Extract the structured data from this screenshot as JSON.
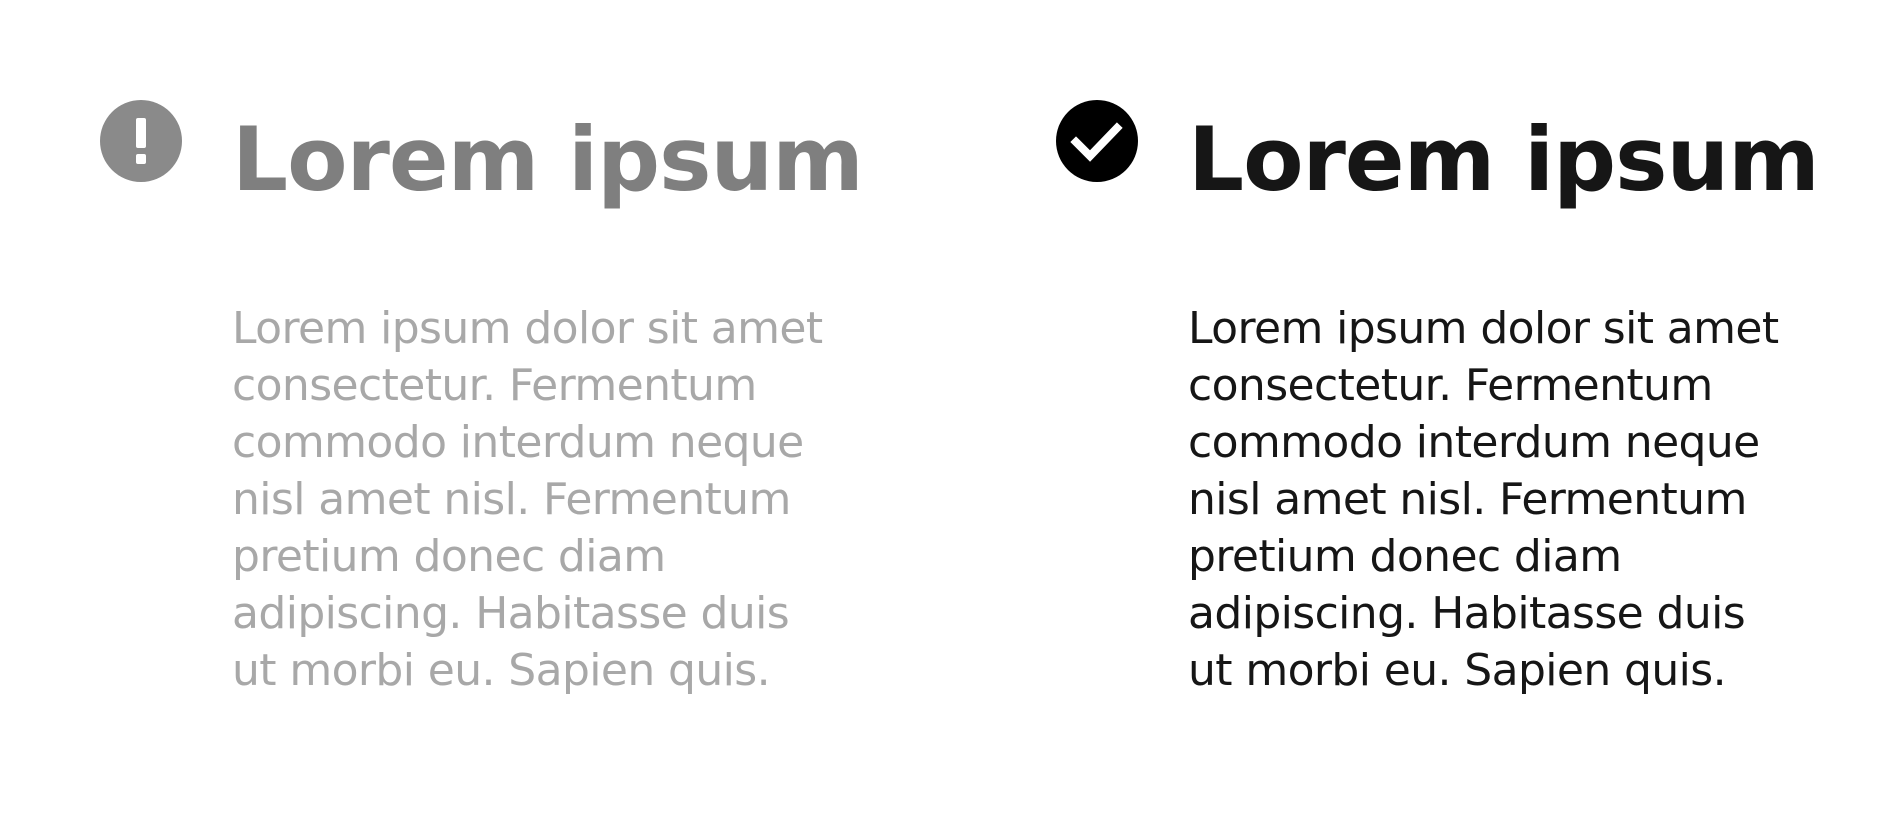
{
  "left_panel": {
    "icon": "warning-exclamation-icon",
    "title": "Lorem ipsum",
    "body_lines": [
      "Lorem ipsum dolor sit amet",
      "consectetur. Fermentum",
      "commodo interdum neque",
      "nisl amet nisl. Fermentum",
      "pretium donec diam",
      "adipiscing. Habitasse duis",
      "ut morbi eu. Sapien quis."
    ],
    "colors": {
      "icon": "#8a8a8a",
      "title": "#7f7f7f",
      "body": "#a8a8a8"
    }
  },
  "right_panel": {
    "icon": "checkmark-circle-icon",
    "title": "Lorem ipsum",
    "body_lines": [
      "Lorem ipsum dolor sit amet",
      "consectetur. Fermentum",
      "commodo interdum neque",
      "nisl amet nisl. Fermentum",
      "pretium donec diam",
      "adipiscing. Habitasse duis",
      "ut morbi eu. Sapien quis."
    ],
    "colors": {
      "icon": "#000000",
      "title": "#161616",
      "body": "#161616"
    }
  }
}
